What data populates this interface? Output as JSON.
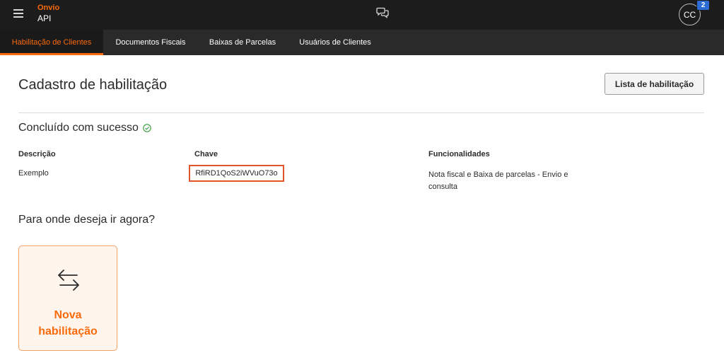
{
  "app": {
    "brand": "Onvio",
    "product": "API",
    "avatar_initials": "CC",
    "notification_count": "2",
    "accent_color": "#fa6a0a"
  },
  "tabs": [
    {
      "label": "Habilitação de Clientes",
      "active": true
    },
    {
      "label": "Documentos Fiscais",
      "active": false
    },
    {
      "label": "Baixas de Parcelas",
      "active": false
    },
    {
      "label": "Usuários de Clientes",
      "active": false
    }
  ],
  "main": {
    "title": "Cadastro de habilitação",
    "list_button": "Lista de habilitação",
    "success_text": "Concluído com sucesso",
    "columns": {
      "description": "Descrição",
      "key": "Chave",
      "features": "Funcionalidades"
    },
    "row": {
      "description": "Exemplo",
      "key": "RfiRD1QoS2iWVuO73o",
      "features": "Nota fiscal e Baixa de parcelas - Envio e consulta"
    },
    "next_prompt": "Para onde deseja ir agora?",
    "card": {
      "label_line1": "Nova",
      "label_line2": "habilitação",
      "icon": "swap-arrows-icon"
    }
  }
}
